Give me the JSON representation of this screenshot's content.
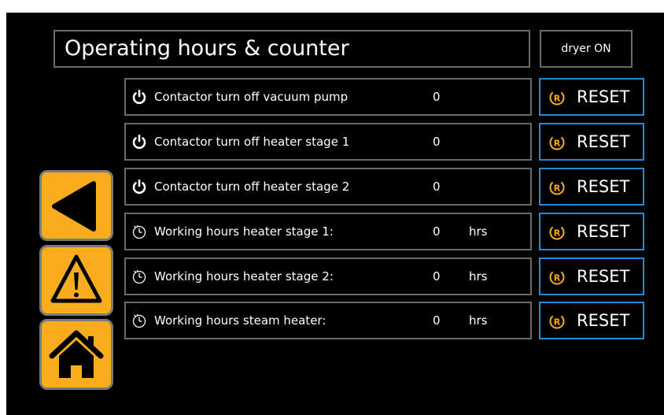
{
  "header": {
    "title": "Operating hours & counter",
    "status": "dryer ON"
  },
  "rows": [
    {
      "icon": "power-icon",
      "label": "Contactor turn off vacuum pump",
      "value": "0",
      "unit": "",
      "reset_label": "RESET"
    },
    {
      "icon": "power-icon",
      "label": "Contactor turn off heater stage 1",
      "value": "0",
      "unit": "",
      "reset_label": "RESET"
    },
    {
      "icon": "power-icon",
      "label": "Contactor turn off heater stage 2",
      "value": "0",
      "unit": "",
      "reset_label": "RESET"
    },
    {
      "icon": "clock-icon",
      "label": "Working hours heater stage 1:",
      "value": "0",
      "unit": "hrs",
      "reset_label": "RESET"
    },
    {
      "icon": "clock-icon",
      "label": "Working hours heater stage 2:",
      "value": "0",
      "unit": "hrs",
      "reset_label": "RESET"
    },
    {
      "icon": "clock-icon",
      "label": "Working hours steam heater:",
      "value": "0",
      "unit": "hrs",
      "reset_label": "RESET"
    }
  ],
  "nav": {
    "buttons": [
      "back-arrow-icon",
      "warning-icon",
      "home-icon"
    ]
  },
  "colors": {
    "background": "#000000",
    "accent": "#f9ad1c",
    "reset_border": "#1e8fd6",
    "box_border": "#6b6b6b",
    "text": "#ffffff"
  }
}
